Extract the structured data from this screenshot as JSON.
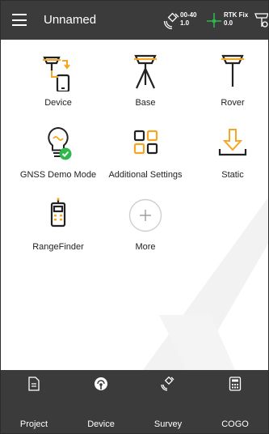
{
  "header": {
    "title": "Unnamed",
    "satellites": {
      "top": "00-40",
      "bottom": "1.0",
      "icon": "satellite-icon"
    },
    "fix": {
      "top": "RTK Fix",
      "bottom": "0.0",
      "icon": "crosshair-icon"
    },
    "rover_icon": "rover-status-icon"
  },
  "tiles": [
    {
      "label": "Device",
      "icon": "device-icon"
    },
    {
      "label": "Base",
      "icon": "base-icon"
    },
    {
      "label": "Rover",
      "icon": "rover-icon"
    },
    {
      "label": "GNSS Demo Mode",
      "icon": "lightbulb-icon"
    },
    {
      "label": "Additional Settings",
      "icon": "grid-icon"
    },
    {
      "label": "Static",
      "icon": "download-icon"
    },
    {
      "label": "RangeFinder",
      "icon": "rangefinder-icon"
    },
    {
      "label": "More",
      "icon": "plus-icon"
    }
  ],
  "bottom_nav": [
    {
      "label": "Project",
      "icon": "project-icon"
    },
    {
      "label": "Device",
      "icon": "device-nav-icon",
      "active": true
    },
    {
      "label": "Survey",
      "icon": "survey-icon"
    },
    {
      "label": "COGO",
      "icon": "calculator-icon"
    }
  ],
  "colors": {
    "bar": "#3b3b3b",
    "accent": "#f5a623",
    "green": "#2eb84b"
  }
}
